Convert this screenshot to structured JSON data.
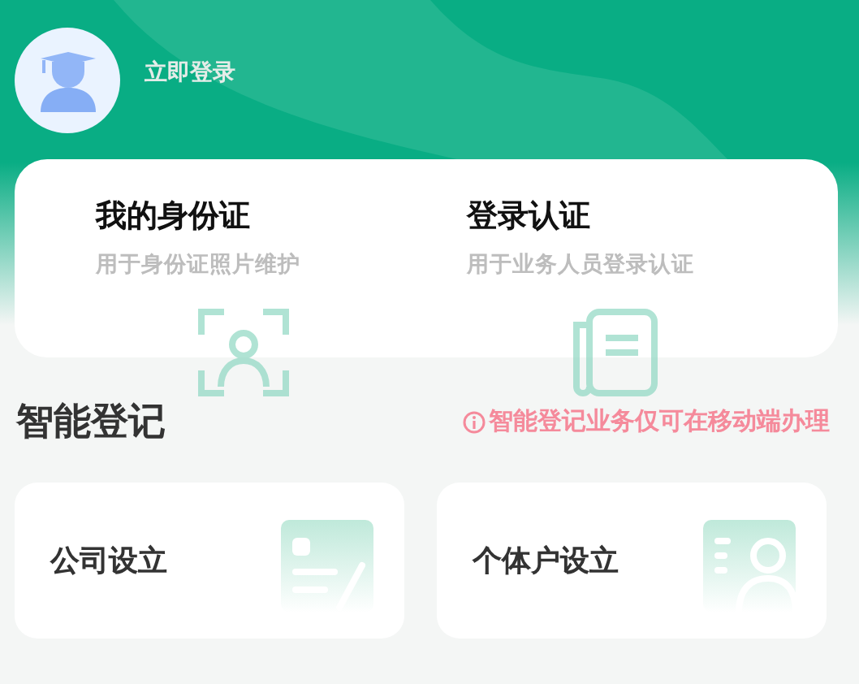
{
  "header": {
    "login_label": "立即登录"
  },
  "id_cards": [
    {
      "kind": "face",
      "title": "我的身份证",
      "subtitle": "用于身份证照片维护"
    },
    {
      "kind": "doc",
      "title": "登录认证",
      "subtitle": "用于业务人员登录认证"
    }
  ],
  "section": {
    "title": "智能登记",
    "notice": "智能登记业务仅可在移动端办理"
  },
  "tiles": [
    {
      "kind": "company",
      "label": "公司设立"
    },
    {
      "kind": "person",
      "label": "个体户设立"
    }
  ]
}
